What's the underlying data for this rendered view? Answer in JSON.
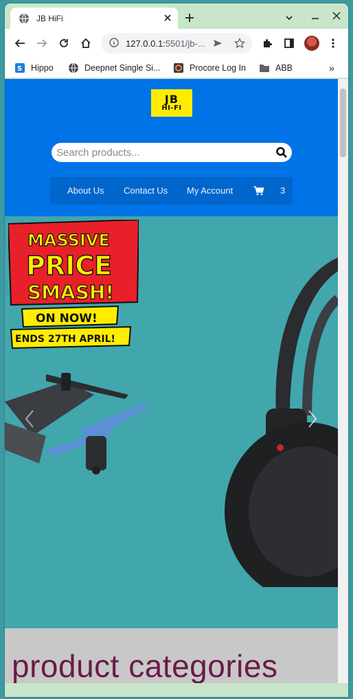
{
  "browser": {
    "tab_title": "JB HiFi",
    "url_host": "127.0.0.1:",
    "url_rest": "5501/jb-...",
    "bookmarks": [
      {
        "label": "Hippo",
        "icon": "sharepoint-icon"
      },
      {
        "label": "Deepnet Single Si...",
        "icon": "globe-icon"
      },
      {
        "label": "Procore Log In",
        "icon": "procore-icon"
      },
      {
        "label": "ABB",
        "icon": "folder-icon"
      }
    ],
    "more_label": "»"
  },
  "site": {
    "logo_line1": "JB",
    "logo_line2": "HI-FI",
    "search_placeholder": "Search products...",
    "nav": [
      {
        "label": "About Us"
      },
      {
        "label": "Contact Us"
      },
      {
        "label": "My Account"
      }
    ],
    "cart_count": "3"
  },
  "hero": {
    "promo_line1": "MASSIVE",
    "promo_line2": "PRICE",
    "promo_line3": "SMASH!",
    "promo_line4": "ON NOW!",
    "promo_line5": "ENDS 27TH APRIL!"
  },
  "categories": {
    "heading": "product categories"
  },
  "colors": {
    "header_blue": "#0073e6",
    "hero_teal": "#42a6ad",
    "logo_yellow": "#ffed00",
    "heading_plum": "#6b1a4a"
  }
}
